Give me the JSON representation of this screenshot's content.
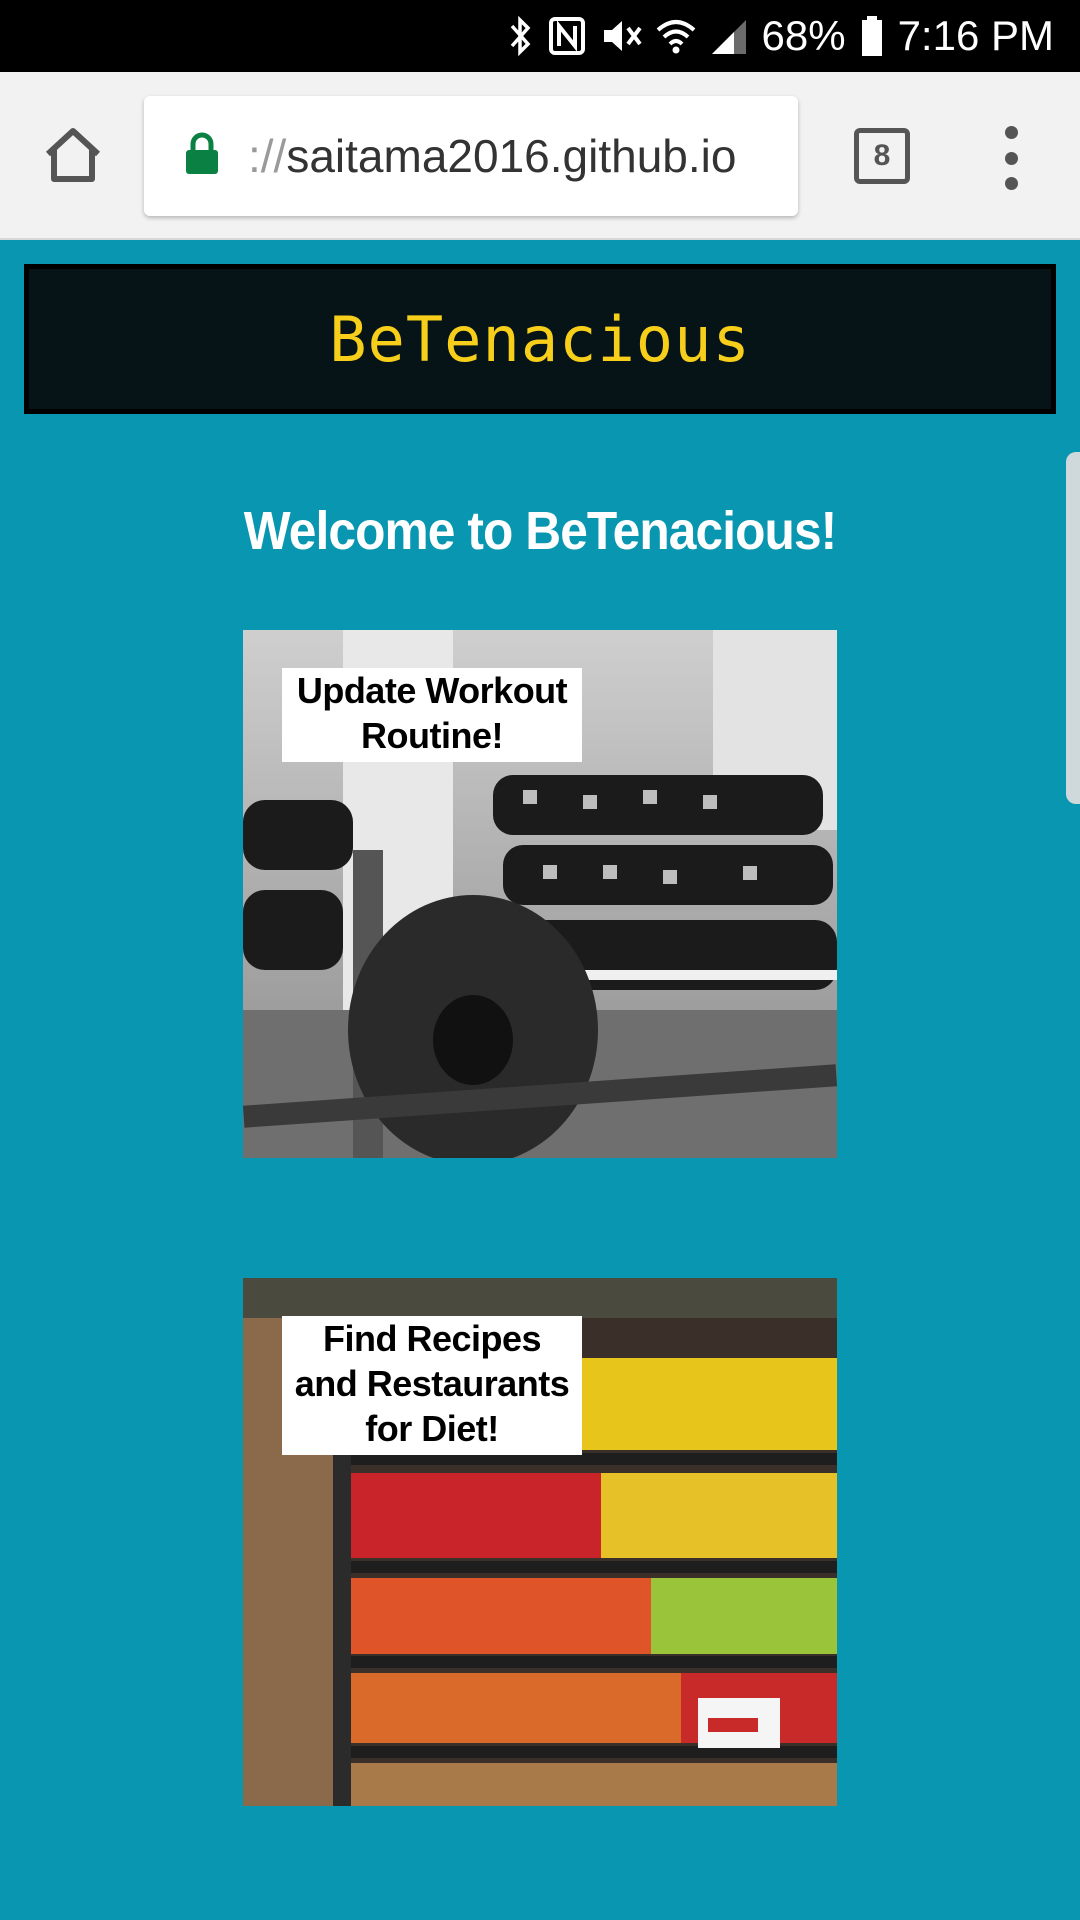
{
  "status_bar": {
    "battery": "68%",
    "time": "7:16 PM",
    "icons": [
      "bluetooth-icon",
      "nfc-icon",
      "mute-icon",
      "wifi-icon",
      "signal-icon",
      "battery-icon"
    ]
  },
  "browser": {
    "url_prefix": "://",
    "url_host": "saitama2016.github.io",
    "tab_count": "8",
    "icons": [
      "home-icon",
      "lock-icon",
      "tabs-icon",
      "more-vert-icon"
    ]
  },
  "header": {
    "title": "BeTenacious",
    "title_color": "#f7cf1a",
    "background": "#061418"
  },
  "main": {
    "welcome": "Welcome to BeTenacious!",
    "cards": [
      {
        "label": "Update Workout Routine!",
        "image": "gym barbell and dumbbells photo"
      },
      {
        "label": "Find Recipes and Restaurants for Diet!",
        "image": "grocery produce shelves photo"
      }
    ]
  },
  "colors": {
    "page_background": "#0896b1",
    "lock_green": "#0b8043"
  }
}
